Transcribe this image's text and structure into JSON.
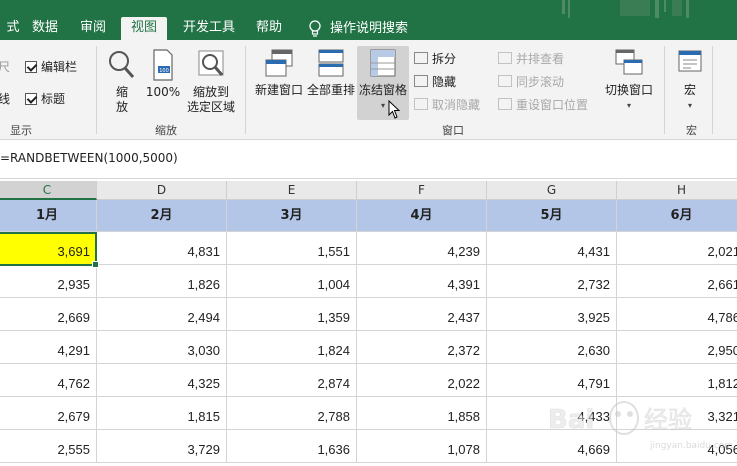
{
  "tabs": {
    "t0": "式",
    "t1": "数据",
    "t2": "审阅",
    "t3": "视图",
    "t4": "开发工具",
    "t5": "帮助",
    "search": "操作说明搜索"
  },
  "ribbon": {
    "show": {
      "partial1": "尺",
      "partial2": "线",
      "formula_bar": "编辑栏",
      "headings": "标题",
      "group": "显示"
    },
    "zoom": {
      "zoom": "缩\n放",
      "zoom_100": "100%",
      "zoom_sel": "缩放到\n选定区域",
      "group": "缩放"
    },
    "window": {
      "new_window": "新建窗口",
      "arrange_all": "全部重排",
      "freeze_panes": "冻结窗格",
      "split": "拆分",
      "hide": "隐藏",
      "unhide": "取消隐藏",
      "side_by_side": "并排查看",
      "sync_scroll": "同步滚动",
      "reset_pos": "重设窗口位置",
      "switch": "切换窗口",
      "group": "窗口"
    },
    "macros": {
      "macros": "宏",
      "group": "宏"
    }
  },
  "formula": "=RANDBETWEEN(1000,5000)",
  "columns": [
    "C",
    "D",
    "E",
    "F",
    "G",
    "H"
  ],
  "header_row": [
    "1月",
    "2月",
    "3月",
    "4月",
    "5月",
    "6月"
  ],
  "rows": [
    [
      "3,691",
      "4,831",
      "1,551",
      "4,239",
      "4,431",
      "2,021"
    ],
    [
      "2,935",
      "1,826",
      "1,004",
      "4,391",
      "2,732",
      "2,661"
    ],
    [
      "2,669",
      "2,494",
      "1,359",
      "2,437",
      "3,925",
      "4,786"
    ],
    [
      "4,291",
      "3,030",
      "1,824",
      "2,372",
      "2,630",
      "2,950"
    ],
    [
      "4,762",
      "4,325",
      "2,874",
      "2,022",
      "4,791",
      "1,812"
    ],
    [
      "2,679",
      "1,815",
      "2,788",
      "1,858",
      "4,433",
      "3,321"
    ],
    [
      "2,555",
      "3,729",
      "1,636",
      "1,078",
      "4,669",
      "4,056"
    ]
  ],
  "watermark": "Bai 经验",
  "colors": {
    "ribbon_green": "#217346",
    "header_fill": "#b4c6e7",
    "highlight": "#ffff00"
  }
}
